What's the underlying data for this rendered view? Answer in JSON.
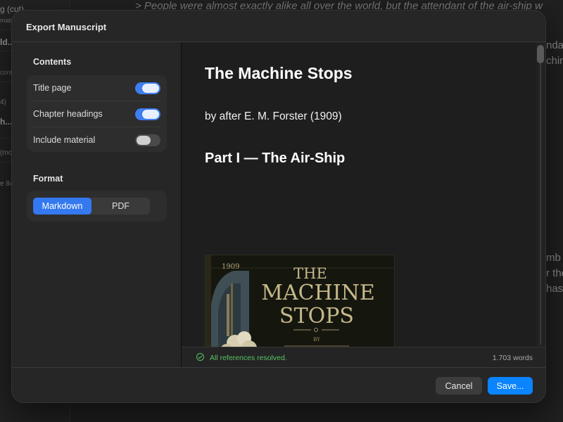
{
  "background": {
    "sidebar_items": [
      "g (cut)",
      "mate",
      "ld...",
      "conti",
      "4)",
      "h...",
      "(mo",
      "e 84"
    ],
    "quote": "> People were almost exactly alike all over the world, but the attendant of the air-ship w",
    "right_fragments": [
      "nda",
      "chin",
      "mb",
      "r the",
      "has"
    ]
  },
  "dialog": {
    "title": "Export Manuscript",
    "contents": {
      "label": "Contents",
      "toggles": [
        {
          "label": "Title page",
          "on": true
        },
        {
          "label": "Chapter headings",
          "on": true
        },
        {
          "label": "Include material",
          "on": false
        }
      ]
    },
    "format": {
      "label": "Format",
      "options": [
        "Markdown",
        "PDF"
      ],
      "selected": "Markdown"
    },
    "preview": {
      "title": "The Machine Stops",
      "author": "by after E. M. Forster (1909)",
      "part": "Part I — The Air-Ship",
      "cover": {
        "year": "1909",
        "line1": "THE",
        "line2": "MACHINE",
        "line3": "STOPS",
        "by": "BY"
      }
    },
    "status": {
      "message": "All references resolved.",
      "word_count": "1.703 words"
    },
    "buttons": {
      "cancel": "Cancel",
      "save": "Save..."
    }
  },
  "colors": {
    "accent": "#0a84ff",
    "toggle_on": "#3e7ef0",
    "status_ok": "#59c265"
  }
}
